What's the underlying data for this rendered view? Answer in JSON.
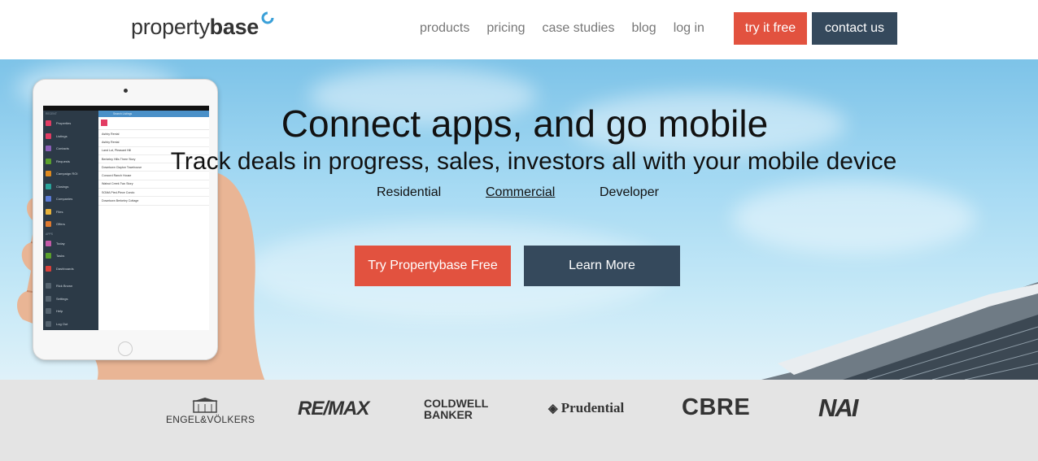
{
  "header": {
    "logo_regular": "property",
    "logo_bold": "base",
    "nav": {
      "products": "products",
      "pricing": "pricing",
      "case_studies": "case studies",
      "blog": "blog",
      "login": "log in"
    },
    "try_free": "try it free",
    "contact": "contact us"
  },
  "hero": {
    "title": "Connect apps, and go mobile",
    "subtitle": "Track deals in progress, sales, investors all with your mobile device",
    "segments": {
      "residential": "Residential",
      "commercial": "Commercial",
      "developer": "Developer"
    },
    "cta_primary": "Try Propertybase Free",
    "cta_secondary": "Learn More"
  },
  "device": {
    "search_placeholder": "Search Listings",
    "sections": {
      "recent": "RECENT",
      "apps": "APPS"
    },
    "sidebar": [
      {
        "label": "Properties",
        "color": "#e23c63"
      },
      {
        "label": "Listings",
        "color": "#e23c63"
      },
      {
        "label": "Contacts",
        "color": "#8b5fb8"
      },
      {
        "label": "Requests",
        "color": "#5aa02c"
      },
      {
        "label": "Campaign ROI",
        "color": "#e08a1e"
      },
      {
        "label": "Closings",
        "color": "#29a39a"
      },
      {
        "label": "Companies",
        "color": "#5b7bd5"
      },
      {
        "label": "Files",
        "color": "#e8b23a"
      },
      {
        "label": "Offers",
        "color": "#e07a2e"
      }
    ],
    "apps": [
      {
        "label": "Today",
        "color": "#c45aa8"
      },
      {
        "label": "Tasks",
        "color": "#5aa02c"
      },
      {
        "label": "Dashboards",
        "color": "#d9413b"
      }
    ],
    "footer_items": [
      "Rick Brown",
      "Settings",
      "Help",
      "Log Out"
    ],
    "list_rows": [
      "Ashby Rental",
      "Ashby Rental",
      "Land Lot, Pleasant Hill",
      "Berkeley Hills Three Story",
      "Downtown Clayton Townhouse",
      "Concord Ranch House",
      "Walnut Creek Two Story",
      "SOMA Pied-Piece Condo",
      "Downtown Berkeley Cottage"
    ]
  },
  "logos": {
    "engel_volkers": "ENGEL&VÖLKERS",
    "remax": "RE/MAX",
    "coldwell_line1": "COLDWELL",
    "coldwell_line2": "BANKER",
    "prudential": "Prudential",
    "cbre": "CBRE",
    "nai": "NAI"
  },
  "colors": {
    "accent_red": "#e2523f",
    "navy": "#35495c",
    "logo_band": "#e4e4e4"
  }
}
